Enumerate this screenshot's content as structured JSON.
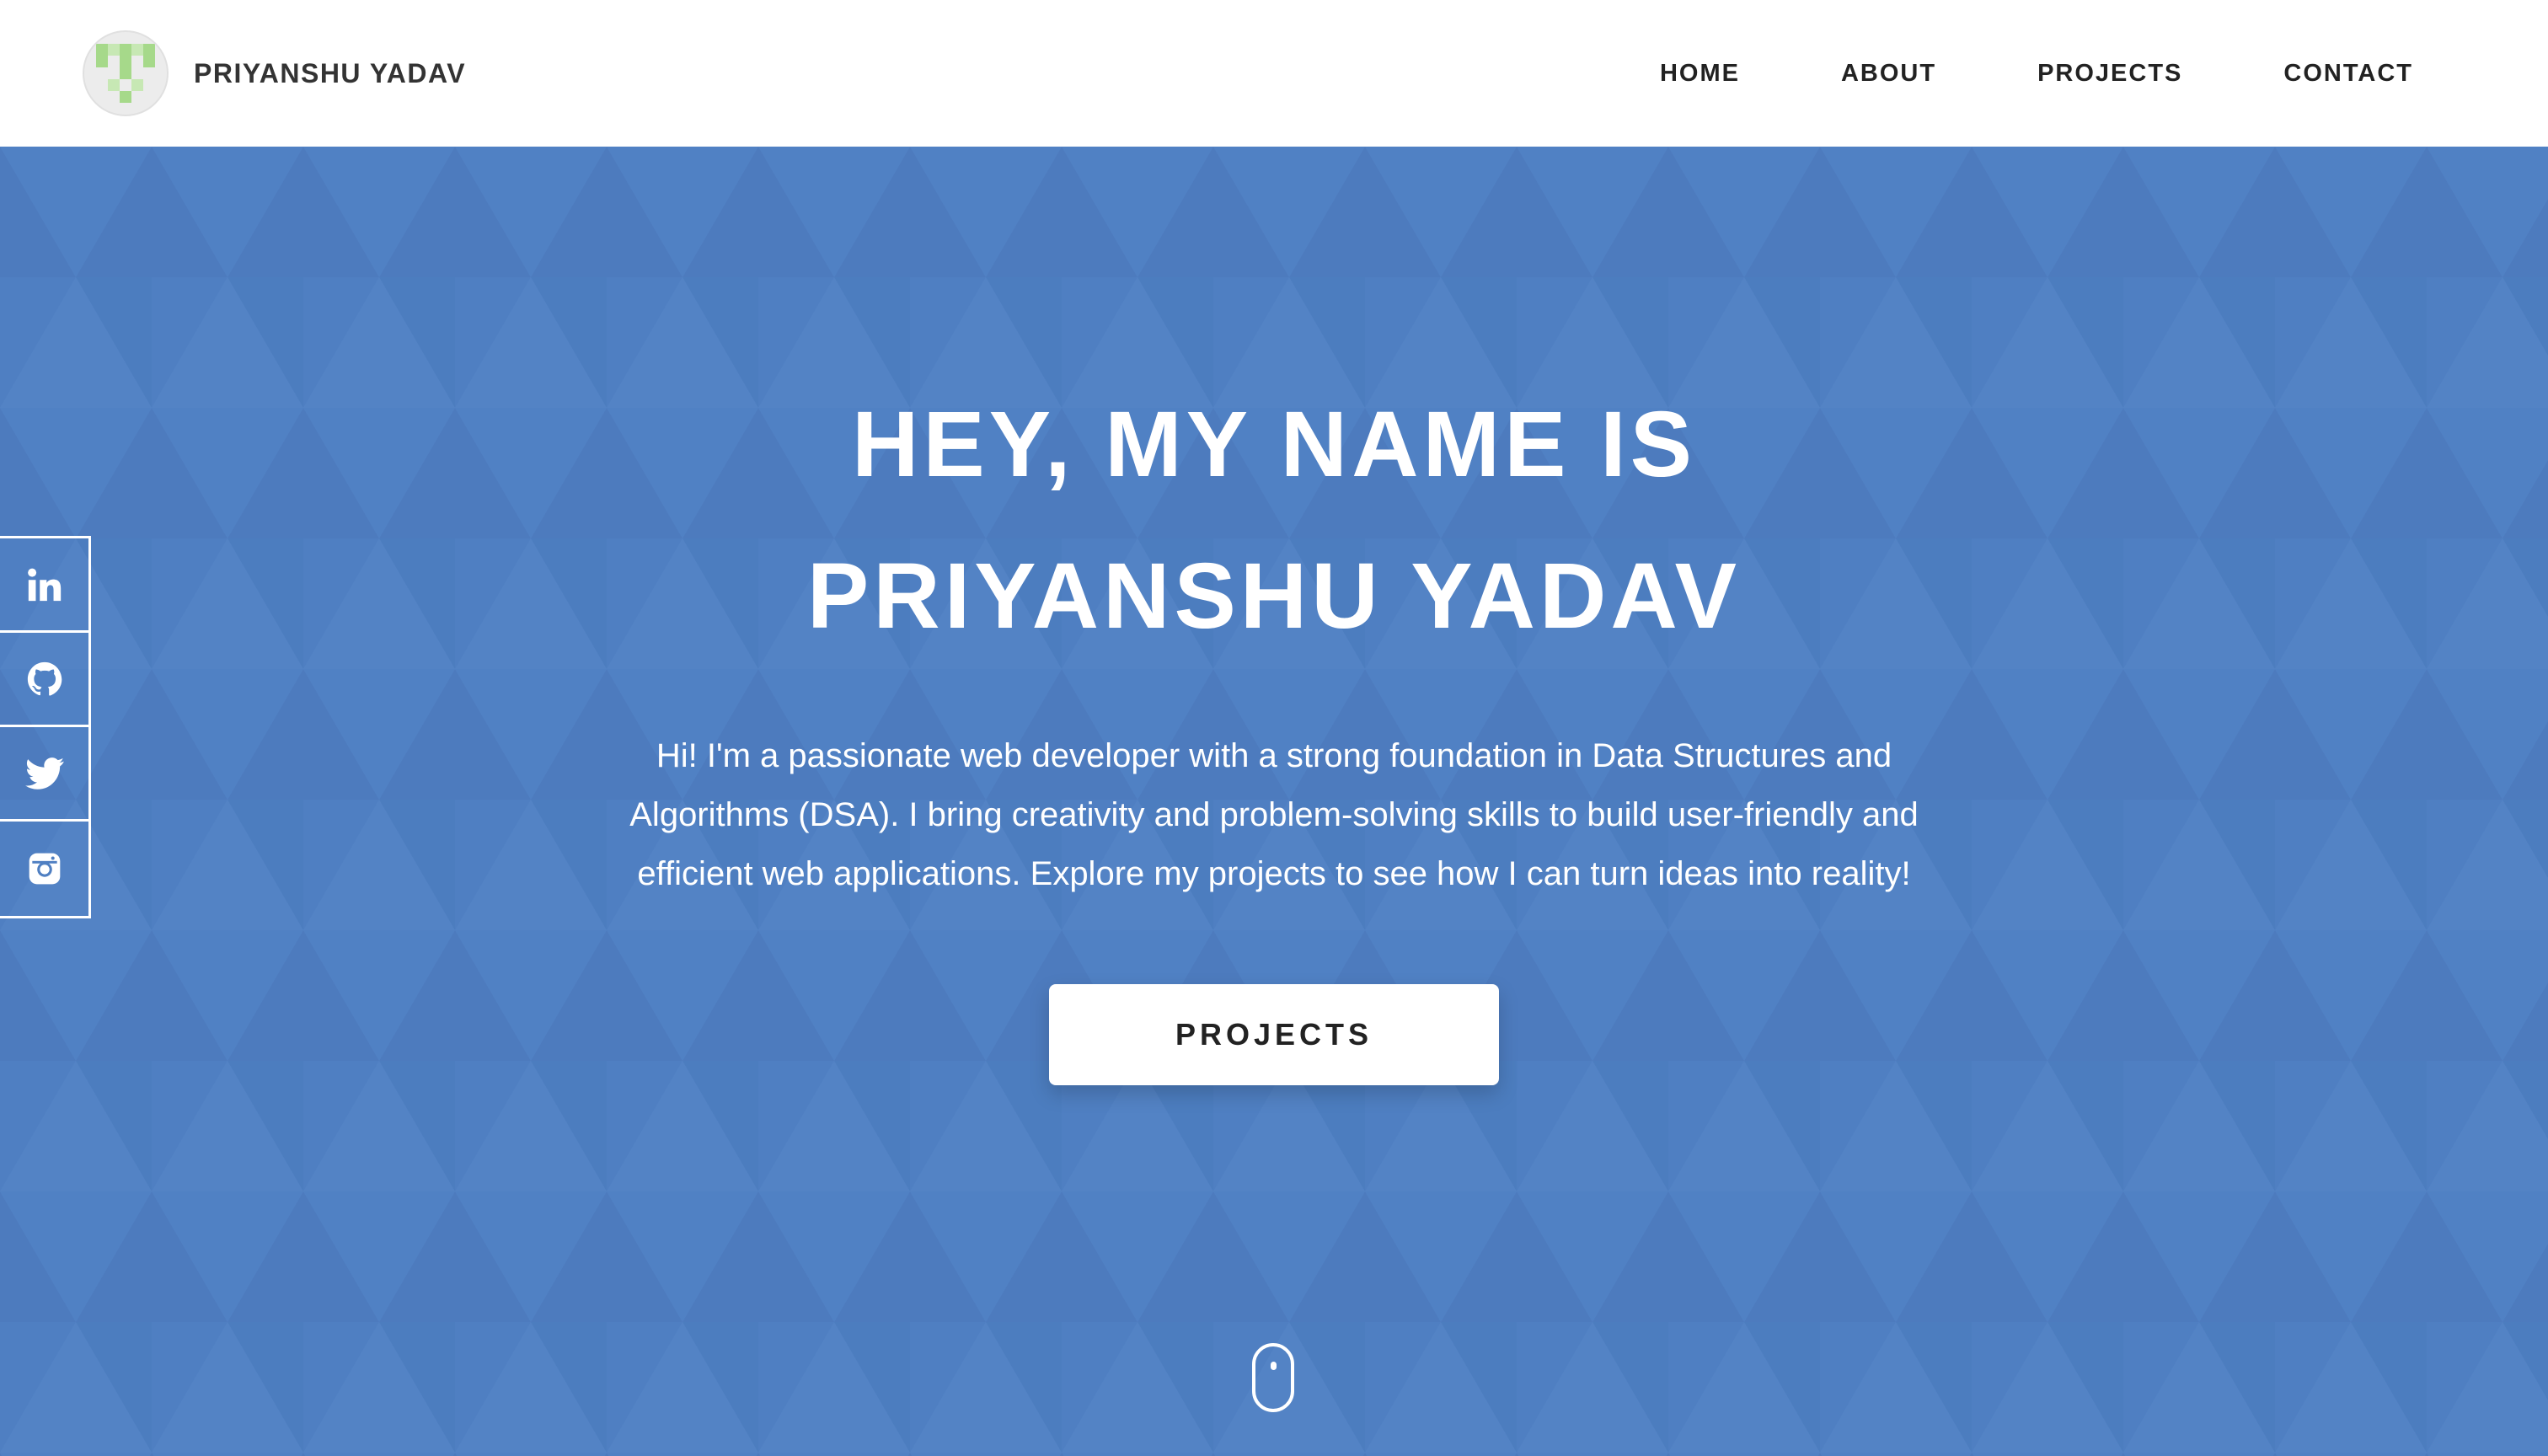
{
  "header": {
    "brand_name": "PRIYANSHU YADAV",
    "avatar_icon": "pixel-avatar-icon",
    "nav": [
      {
        "label": "HOME"
      },
      {
        "label": "ABOUT"
      },
      {
        "label": "PROJECTS"
      },
      {
        "label": "CONTACT"
      }
    ]
  },
  "hero": {
    "headline_line1": "HEY, MY NAME IS",
    "headline_line2": "PRIYANSHU YADAV",
    "intro_line1": "Hi! I'm a passionate web developer with a strong foundation in Data Structures and",
    "intro_line2": "Algorithms (DSA). I bring creativity and problem-solving skills to build user-friendly and",
    "intro_line3": "efficient web applications. Explore my projects to see how I can turn ideas into reality!",
    "cta_label": "PROJECTS",
    "scroll_icon": "mouse-scroll-icon"
  },
  "social": [
    {
      "icon": "linkedin-icon"
    },
    {
      "icon": "github-icon"
    },
    {
      "icon": "twitter-icon"
    },
    {
      "icon": "instagram-icon"
    }
  ],
  "colors": {
    "hero_background": "#4f7fc2",
    "header_background": "#ffffff",
    "avatar_accent": "#a6d98a",
    "text_light": "#ffffff",
    "text_dark": "#222222"
  }
}
